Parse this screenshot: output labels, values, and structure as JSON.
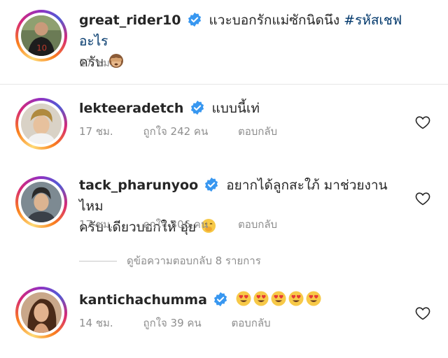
{
  "colors": {
    "link": "#00376b",
    "muted": "#8e8e8e",
    "verified": "#3897f0"
  },
  "post": {
    "username": "great_rider10",
    "text": "แวะบอกรักแม่ซักนิดนึง",
    "hashtag": "#รหัสเชฟอะไร",
    "text2": "ครับ",
    "emoji": "see-no-evil-monkey-icon",
    "time": "17 ชม."
  },
  "comments": [
    {
      "username": "lekteeradetch",
      "text": "แบบนี้เท่",
      "time": "17 ชม.",
      "likes": "ถูกใจ 242 คน",
      "reply": "ตอบกลับ"
    },
    {
      "username": "tack_pharunyoo",
      "text": "อยากได้ลูกสะใภ้ มาช่วยงานไหม",
      "text2": "ครับ เดียวบอกให้ อุ่ย",
      "time": "17 ชม.",
      "likes": "ถูกใจ 306 คน",
      "reply": "ตอบกลับ"
    },
    {
      "username": "kantichachumma",
      "text": "",
      "time": "14 ชม.",
      "likes": "ถูกใจ 39 คน",
      "reply": "ตอบกลับ"
    }
  ],
  "view_replies": "ดูข้อความตอบกลับ 8 รายการ"
}
